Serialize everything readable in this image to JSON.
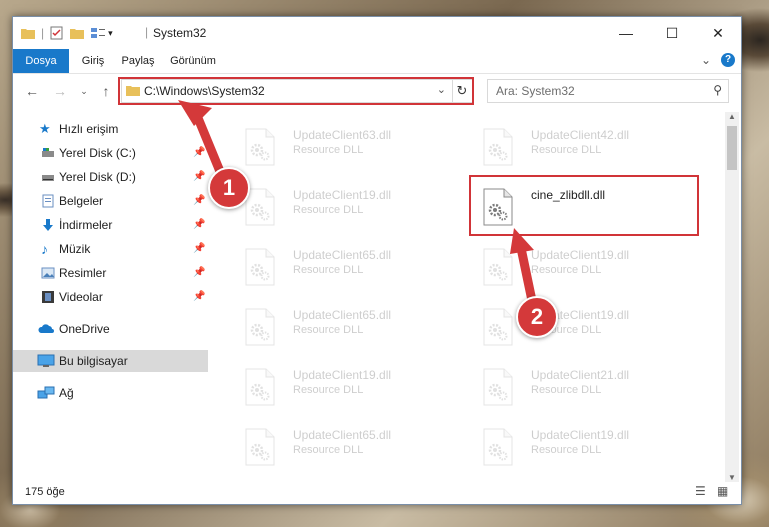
{
  "window": {
    "title": "System32",
    "controls": {
      "minimize": "—",
      "maximize": "☐",
      "close": "✕"
    }
  },
  "ribbon": {
    "tabs": [
      "Dosya",
      "Giriş",
      "Paylaş",
      "Görünüm"
    ],
    "active_tab": "Dosya",
    "expand_icon": "⌄",
    "help_icon": "?"
  },
  "address": {
    "path": "C:\\Windows\\System32",
    "search_placeholder": "Ara: System32"
  },
  "nav": {
    "quick_access": "Hızlı erişim",
    "items": [
      {
        "label": "Yerel Disk (C:)",
        "icon": "drive-icon",
        "pinned": true
      },
      {
        "label": "Yerel Disk (D:)",
        "icon": "drive-icon",
        "pinned": true
      },
      {
        "label": "Belgeler",
        "icon": "documents-icon",
        "pinned": true
      },
      {
        "label": "İndirmeler",
        "icon": "downloads-icon",
        "pinned": true
      },
      {
        "label": "Müzik",
        "icon": "music-icon",
        "pinned": true
      },
      {
        "label": "Resimler",
        "icon": "pictures-icon",
        "pinned": true
      },
      {
        "label": "Videolar",
        "icon": "videos-icon",
        "pinned": true
      }
    ],
    "onedrive": "OneDrive",
    "this_pc": "Bu bilgisayar",
    "network": "Ağ"
  },
  "files": [
    {
      "name": "UpdateClient63.dll",
      "desc": "Resource DLL",
      "faded": true
    },
    {
      "name": "UpdateClient42.dll",
      "desc": "Resource DLL",
      "faded": true
    },
    {
      "name": "UpdateClient19.dll",
      "desc": "Resource DLL",
      "faded": true
    },
    {
      "name": "cine_zlibdll.dll",
      "desc": "",
      "faded": false
    },
    {
      "name": "UpdateClient65.dll",
      "desc": "Resource DLL",
      "faded": true
    },
    {
      "name": "UpdateClient19.dll",
      "desc": "Resource DLL",
      "faded": true
    },
    {
      "name": "UpdateClient65.dll",
      "desc": "Resource DLL",
      "faded": true
    },
    {
      "name": "UpdateClient19.dll",
      "desc": "Resource DLL",
      "faded": true
    },
    {
      "name": "UpdateClient19.dll",
      "desc": "Resource DLL",
      "faded": true
    },
    {
      "name": "UpdateClient21.dll",
      "desc": "Resource DLL",
      "faded": true
    },
    {
      "name": "UpdateClient65.dll",
      "desc": "Resource DLL",
      "faded": true
    },
    {
      "name": "UpdateClient19.dll",
      "desc": "Resource DLL",
      "faded": true
    }
  ],
  "status": {
    "count": "175 öğe"
  },
  "markers": [
    "1",
    "2"
  ],
  "colors": {
    "accent": "#1979ca",
    "highlight": "#d13438",
    "selection": "#d9d9d9"
  }
}
